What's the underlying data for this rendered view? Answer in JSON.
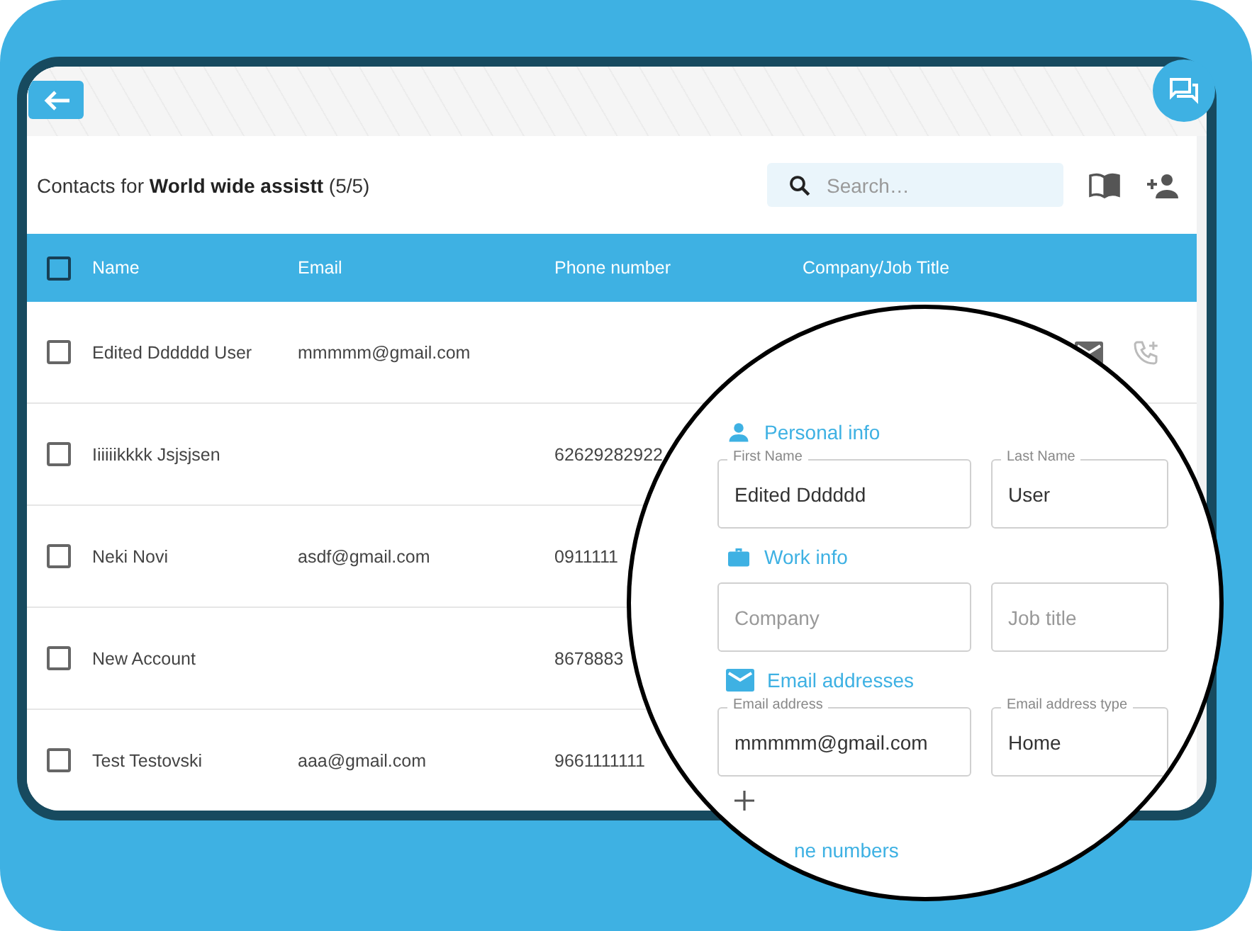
{
  "header": {
    "title": "Contacts for **World wide assistt** (5/5)"
  },
  "search": {
    "placeholder": "Search…"
  },
  "table": {
    "select_all": {
      "checked": false
    },
    "columns": [
      "Name",
      "Email",
      "Phone number",
      "Company/Job Title"
    ],
    "rows": [
      {
        "checked": false,
        "name": "Edited Dddddd User",
        "email": "mmmmm@gmail.com",
        "phone": "",
        "actions": true
      },
      {
        "checked": false,
        "name": "Iiiiiikkkk Jsjsjsen",
        "email": "",
        "phone": "62629282922",
        "actions": false
      },
      {
        "checked": false,
        "name": "Neki Novi",
        "email": "asdf@gmail.com",
        "phone": "0911111",
        "actions": false
      },
      {
        "checked": false,
        "name": "New Account",
        "email": "",
        "phone": "8678883",
        "actions": false
      },
      {
        "checked": false,
        "name": "Test Testovski",
        "email": "aaa@gmail.com",
        "phone": "9661111111",
        "actions": false
      }
    ]
  },
  "magnifier": {
    "sections": [
      {
        "kind": "person",
        "title": "Personal info",
        "fields": [
          {
            "label": "First Name",
            "value": "Edited Dddddd"
          },
          {
            "label": "Last Name",
            "value": "User"
          }
        ]
      },
      {
        "kind": "work",
        "title": "Work info",
        "fields": [
          {
            "placeholder": "Company"
          },
          {
            "placeholder": "Job title"
          }
        ]
      },
      {
        "kind": "email",
        "title": "Email addresses",
        "fields": [
          {
            "label": "Email address",
            "value": "mmmmm@gmail.com"
          },
          {
            "label": "Email address type",
            "value": "Home"
          }
        ],
        "addable": true
      }
    ],
    "next_section": "ne numbers"
  }
}
